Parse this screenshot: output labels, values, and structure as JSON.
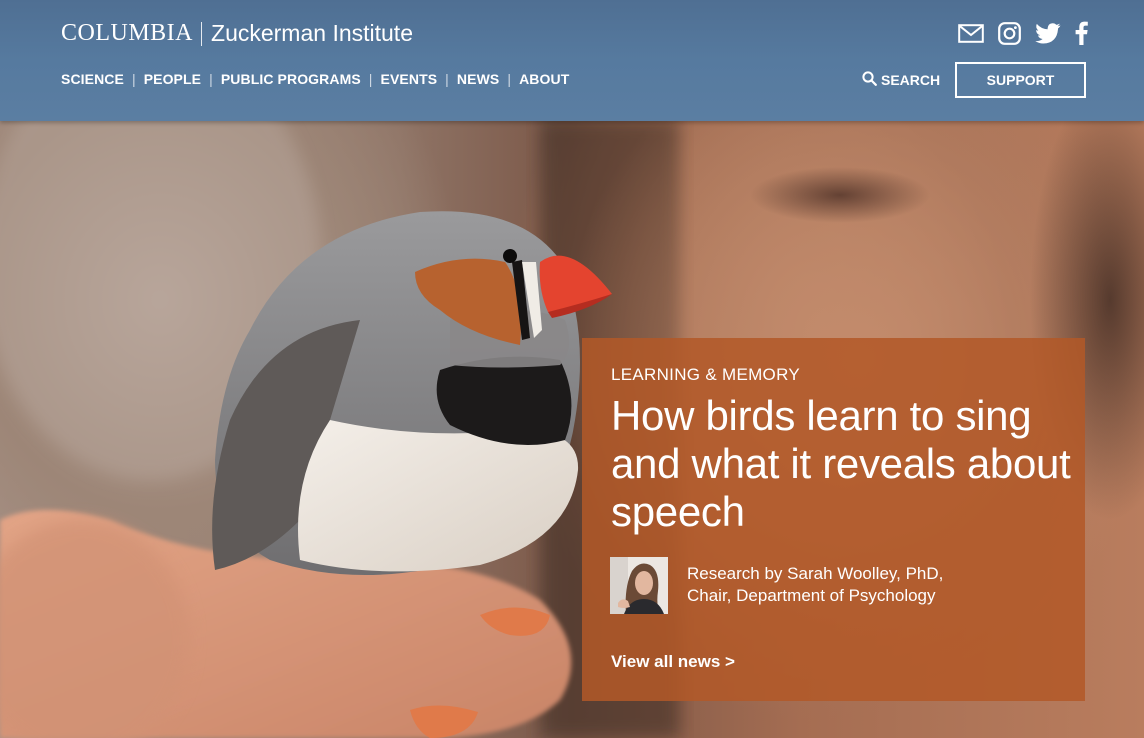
{
  "header": {
    "brand_primary": "COLUMBIA",
    "brand_secondary": "Zuckerman Institute",
    "nav": [
      {
        "label": "SCIENCE"
      },
      {
        "label": "PEOPLE"
      },
      {
        "label": "PUBLIC PROGRAMS"
      },
      {
        "label": "EVENTS"
      },
      {
        "label": "NEWS"
      },
      {
        "label": "ABOUT"
      }
    ],
    "search_label": "SEARCH",
    "support_label": "SUPPORT",
    "social_icons": [
      "mail-icon",
      "instagram-icon",
      "twitter-icon",
      "facebook-icon"
    ],
    "bar_color": "#567a9f"
  },
  "feature": {
    "category": "LEARNING & MEMORY",
    "title": "How birds learn to sing and what it reveals about speech",
    "byline_line1": "Research by Sarah Woolley, PhD,",
    "byline_line2": "Chair, Department of Psychology",
    "link_label": "View all news >",
    "card_color": "#b25828"
  }
}
